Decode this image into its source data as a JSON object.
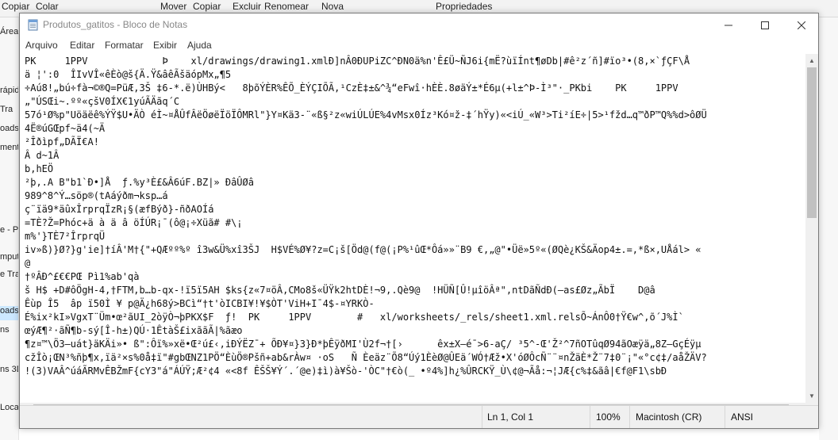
{
  "background": {
    "toolbar": [
      "Copiar",
      "Colar",
      "Mover",
      "Copiar",
      "Excluir",
      "Renomear",
      "Nova",
      "Propriedades"
    ],
    "sidebar": [
      "Área",
      "rápid",
      "Tra",
      "oads",
      "ment",
      "e - P",
      "mput",
      "e Tra",
      "oads",
      "ns",
      "ns 3D",
      "Local"
    ]
  },
  "window": {
    "title": "Produtos_gatitos - Bloco de Notas",
    "app_icon": "notepad-icon",
    "minimize_icon": "minimize-icon",
    "maximize_icon": "maximize-icon",
    "close_icon": "close-icon"
  },
  "menu": {
    "items": [
      "Arquivo",
      "Editar",
      "Formatar",
      "Exibir",
      "Ajuda"
    ]
  },
  "content": {
    "lines": [
      "PK\u0003\u0004  \u0014 \u0006  1PPV             Þ    xl/drawings/drawing1.xmlÐ]nÂ0\u0010\u0006Ð\u001d\u0010UPiZ\u0018C^ÐN0ä%n\u0001'Ê\u0010£Ü~ÑJ6i{mË?ùïÍnt¶øDb\u001a|#ê²\u0019z\u0011´ñ]#\u0018ïo³•(8,×`ƒÇF\\Å",
      "ä ¦':0  ÎIvVÎ«êÈò@\u0014š{Ä.Ÿ&âêÃ\u0014šäópMx„¶5",
      "÷Aú8!„\u0001bú\u0016÷fà¬©®Q=PüÆ\u0014,3Š ‡6-*.ë)ÙHBý<   8þ\u001aõÝÈR%ÊÕ_ÈÝ\u0003ÇIÕÃ,¹CzÈ‡±&^¾“eFwî·h\u0011ÈÈ.8øäÝ±*É6µ(+l±^Þ-Ì³\"·_PK\u001b\u0001bi\u001b\u000e  \u000e  PK\u0003\u0004  \u0014 \u0006  1PPV",
      "„\"ÚSŒi~.ºº«çšV\u00010ÍX€1yúÃÄãq´C",
      "57ó¹Ø%p\"Uöäëê%ÝŸ$U•ÄÒ éÌ~¤Å\u0012ÛfÂëÖøëÏöÏ\u0016ÔMRl\"}Y¤Kä3-¨«ß\u0013§²z«wiÚLÚ\u0007E%4vMsx0Íz³Kó¤ž-‡´hŸy)«<iÚ_«W³>Ti²í\u001bE÷|5>¹fžd…q™ðP™Q%%d>ôØÜ",
      "\u00184Ë®úGŒpf~ä\u00014(~Ä",
      "²Îðìpf\u0010„DÃÏ€A!",
      "Â \u0011\u0011d~1Â",
      "b,\u0011hEÖ",
      "²þ,.A\u0014 \u001aB\u0006\"\u001ab1`Ð•\u0001]Å  ƒ.%y³È£&Â6ú\u0014F.B\u001aZ|\u001a» ÐâÛØâ",
      "9\u00118\u00059^8^Ý\u0012…söp®(tAáýðm¬ksp…\u0012á",
      "ç¨ïä9*äûxÎ\u001dr\u0001p\u0003r\u0001q\u0010Ï\u0011\u0011zR¡§(æfB\u0001ýð}-ñ\u0012ð\u0012AOÍá",
      "=TÈ?Ž=Phóc+ä à ä â öÍ\u0001ÚR¡¯(ô@¡÷Xüã\u0007# \u0001#\\¡\u0010",
      "m%'}TÈ7²Î\u001dr\u0001p\u0003r\u0001q\u0010\u0001Ü",
      "iv»ß)\u0001}Ø?}g'ie]†íÂ'M†{\"+QÆºº%º î3w&Ü%xî3ŠJ  \u0010\u0010H\u0010$VÉ%Ø¥?z=C¡š[\u0011Öd@(f@(¡P%¹ûŒ*Ôá»»¨B9 €,„@\"•Üë»5\u0011º«(ØQè¿KŠ&Äop4\u0001±.=,*\u0001ß×,UÅál> «",
      "\u0011@",
      "†ºÂÐ^\u0010£€€PŒ Pì1\u0010%ab'qà",
      "\u0011š\u001e H\u0011$ \u0011+D#ôÖgH-4,†FT\u0010M\u0011,b…b-qx-!ï5\u0011ï5\u0011A\u0011H $\u0011\u0011\u0011ks{\u0014z«7¤ö\u0001Â,C\u0016M\u0014o8š«ÜŸk2htDÈ!¬9,.Qè9@  !\u0001\u0001HÜ\u0011\u0011Ñ[Û!µî\u0011öÂª\",ntDãÑdÐ(–as£Øz„ÃbÏ\u0011    D@â",
      "Ê\u0006ù\u0014p\u0001 Î5 \u0011 â\u0011p\u0011 ï50\u0011Ì ¥\u0011 \u0011\u0011p@Ä¿\u0011h68\u0001ý>BC\u0011ì“†t'òICBI\u0011¥!¥$ÒT'ViH+I¯4$-¤Y\u0011RKÒ-",
      "É%ix\u0011²kI»VgxT¨Üm•œ²ãUI_2òÿÒ¬þPK\u0001\u0002\u0011X$F\u0011\u0011  ƒ!  PK\u0003\u0004  \u0014 \u0006  1PPV        #   xl/worksheets/_rels/sheet1.xml.relsÕ~ÁnÔ0\u0010†Ÿ€w^,õ´J%Ì`",
      "œýÆ¶²·ã\u0012Ñ¶b-sý[Î-h±\u0001)QÚ·1ÊtàŠ£ix\u0002ã\u0011\u0011ãÃ|%ãæo",
      "¶z¤™\\Ö\u00113–uá\u0006t}äKÄi»• ß\"\u0002:Ôï%»xë•Œ²ú£‹,iÐÝËZ¯+ ÕÐ¥¤}3}\u0011Ð\u0010*þÊ\u0005\u001eÿðMI'Ù2f\u0001¬†[›      êx±X–é¯>\u00116-aÇ/\u0001 ³5^-Œ'Ž²^7\u0001ñOTûq\u0011Ø94\u0011ãO\u0011æÿä„\u00018Z—GçÉÿµ",
      "cžÎò¡ŒN³%ñþ¶x,ïä²×s%0å‡ï\"#gbŒNZ1PÖ“ÈùÖ®Pšñ+ab&rÀw¤ ·oS   Ñ Èeä\u0011\u0011z¨Õ8“Úý1ÈèØ@ÛEä´WÓ†\u0011Æž•\u0011\u0011X'óØ\u0010Ôc\u0011Ñ¨¨¤n\u0001\u0011ŽäÈ\u0011*Ž¨7‡0¨¡\"«°c¢‡/aåŽÄV?",
      "!\u0010(3)VAÂ^ú\u0011áÃRMvÊBŽ\u0001mF{cY3\"á\"ÁÚŸ;Æ²¢4 «<8f ÊŠ\u0011Š¥Ý´.´\u0001\u001a@e)‡ì)à¥Šò-'ÒC\"†€ò(_ •º4%]h\u0011¿%ÛR\u0001CKŸ_Ù\\¢@\u0011¬Ãå:¬¦JÆ{c%‡&ã\u0011â|€f@F1\\\u0011s\u0011bÐ"
    ]
  },
  "status": {
    "position": "Ln 1, Col 1",
    "zoom": "100%",
    "line_ending": "Macintosh (CR)",
    "encoding": "ANSI"
  }
}
